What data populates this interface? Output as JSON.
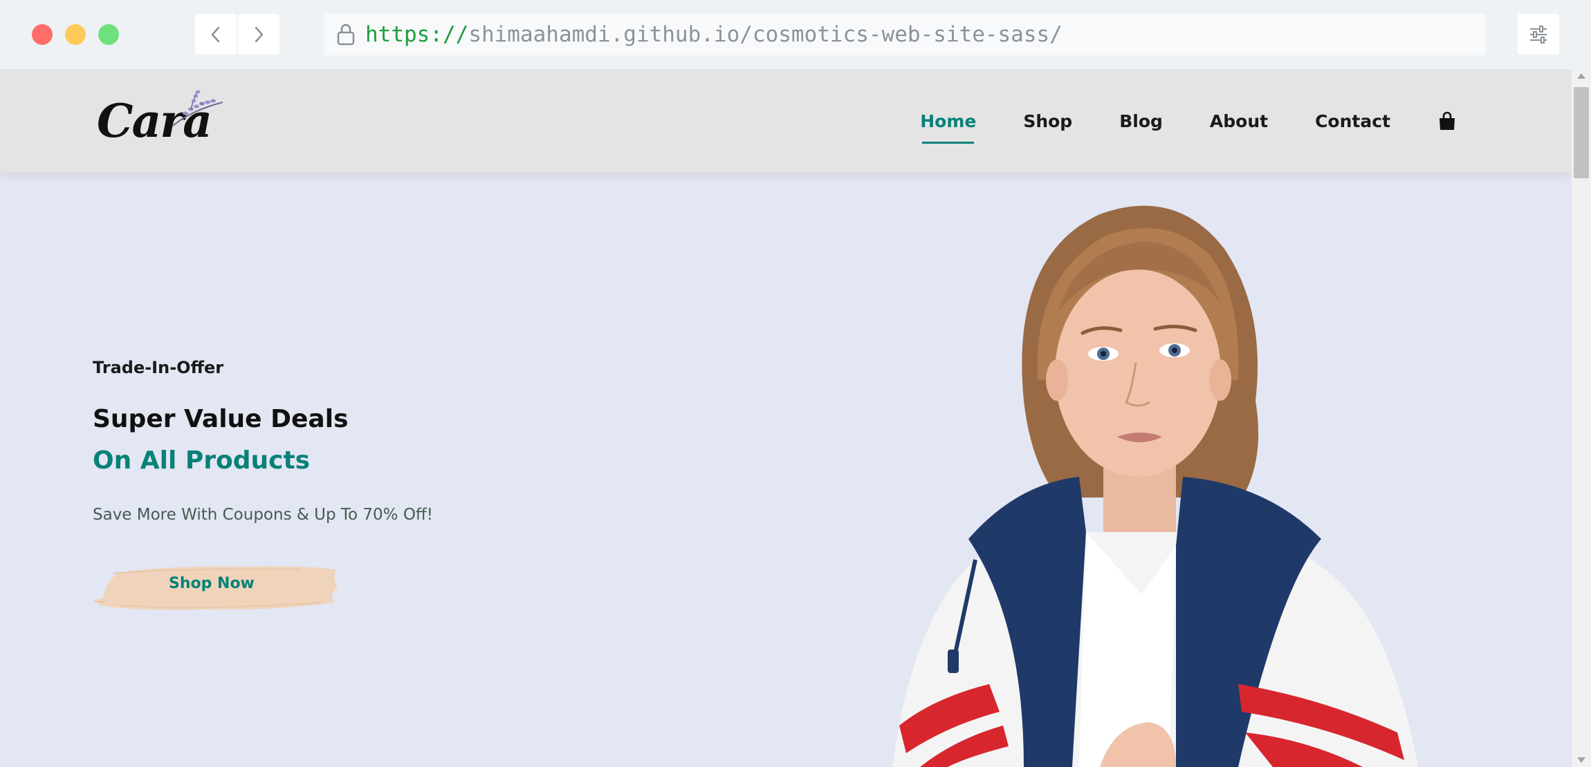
{
  "browser": {
    "url_scheme": "https://",
    "url_rest": "shimaahamdi.github.io/cosmotics-web-site-sass/"
  },
  "site": {
    "logo_text": "Cara",
    "nav": [
      {
        "label": "Home",
        "active": true
      },
      {
        "label": "Shop",
        "active": false
      },
      {
        "label": "Blog",
        "active": false
      },
      {
        "label": "About",
        "active": false
      },
      {
        "label": "Contact",
        "active": false
      }
    ]
  },
  "hero": {
    "tag": "Trade-In-Offer",
    "headline": "Super Value Deals",
    "subheadline": "On All Products",
    "description": "Save More With Coupons & Up To 70% Off!",
    "cta_label": "Shop Now"
  },
  "colors": {
    "accent": "#088178",
    "hero_background": "#e3e6f3",
    "header_background": "#e4e4e4",
    "button_brush": "#f0d5bd"
  },
  "icons": [
    "chevron-left-icon",
    "chevron-right-icon",
    "lock-icon",
    "settings-sliders-icon",
    "cart-icon"
  ]
}
